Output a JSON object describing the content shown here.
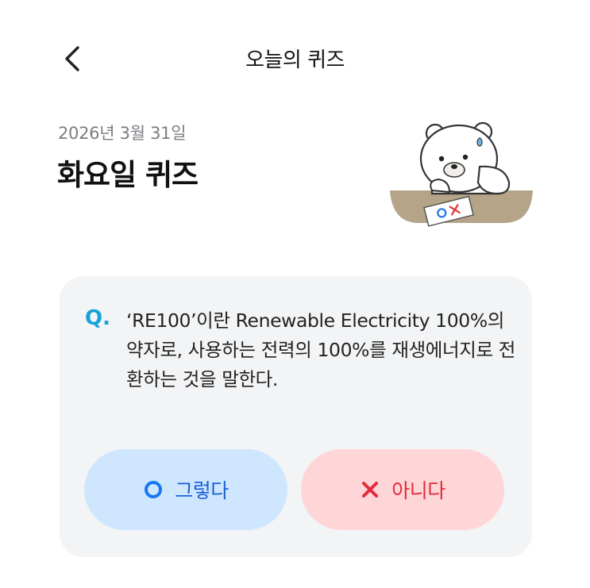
{
  "header": {
    "title": "오늘의 퀴즈",
    "back_icon": "chevron-left-icon"
  },
  "quiz_meta": {
    "date": "2026년 3월 31일",
    "day_title": "화요일 퀴즈"
  },
  "mascot": {
    "name": "bear-mascot",
    "sheet_marks": "OX"
  },
  "quiz": {
    "q_mark": "Q.",
    "question": "‘RE100’이란 Renewable Electricity 100%의 약자로, 사용하는 전력의 100%를 재생에너지로 전환하는 것을 말한다."
  },
  "answers": {
    "yes": {
      "label": "그렇다",
      "icon": "circle-o-icon",
      "color": "#1b5fd6"
    },
    "no": {
      "label": "아니다",
      "icon": "x-icon",
      "color": "#e32a3a"
    }
  },
  "colors": {
    "q_accent": "#12a4d9",
    "card_bg": "#f3f4f6",
    "yes_bg": "#cfe6ff",
    "no_bg": "#ffd6d8"
  }
}
